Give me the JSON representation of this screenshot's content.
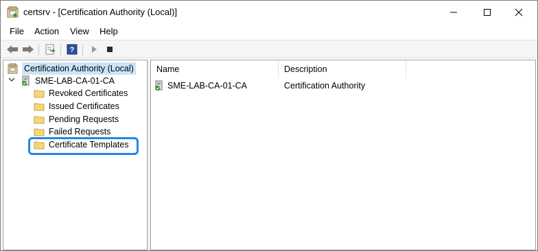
{
  "window": {
    "title": "certsrv - [Certification Authority (Local)]",
    "app_icon": "certsrv-icon",
    "controls": {
      "minimize": "—",
      "maximize": "☐",
      "close": "✕"
    }
  },
  "menu": {
    "items": [
      "File",
      "Action",
      "View",
      "Help"
    ]
  },
  "toolbar": {
    "icons": [
      "back-arrow-icon",
      "forward-arrow-icon",
      "export-list-icon",
      "help-icon",
      "play-icon",
      "stop-icon"
    ]
  },
  "tree": {
    "root": "Certification Authority (Local)",
    "ca": {
      "label": "SME-LAB-CA-01-CA",
      "expanded": true,
      "children": [
        "Revoked Certificates",
        "Issued Certificates",
        "Pending Requests",
        "Failed Requests",
        "Certificate Templates"
      ]
    },
    "highlighted": "Certificate Templates",
    "highlight_color": "#1e88e5",
    "selection_color": "#cce4f7"
  },
  "list": {
    "columns": [
      "Name",
      "Description"
    ],
    "rows": [
      {
        "name": "SME-LAB-CA-01-CA",
        "description": "Certification Authority"
      }
    ]
  }
}
